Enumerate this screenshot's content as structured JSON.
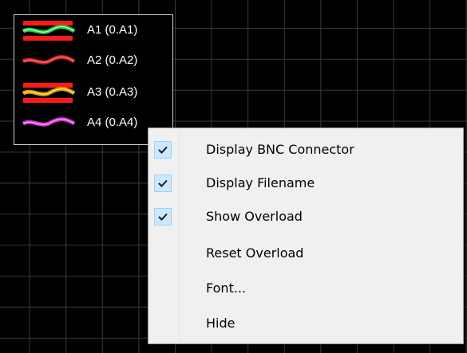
{
  "legend": {
    "items": [
      {
        "label": "A1 (0.A1)",
        "wave_color": "#22cc44",
        "overload": true
      },
      {
        "label": "A2 (0.A2)",
        "wave_color": "#cc2222",
        "overload": false
      },
      {
        "label": "A3 (0.A3)",
        "wave_color": "#d4a000",
        "overload": true
      },
      {
        "label": "A4 (0.A4)",
        "wave_color": "#cc33cc",
        "overload": false
      }
    ]
  },
  "context_menu": {
    "items": [
      {
        "label": "Display BNC Connector",
        "checked": true,
        "icon": "checkmark-icon"
      },
      {
        "label": "Display Filename",
        "checked": true,
        "icon": "checkmark-icon"
      },
      {
        "label": "Show Overload",
        "checked": true,
        "icon": "checkmark-icon"
      },
      {
        "label": "Reset Overload",
        "checked": false
      },
      {
        "label": "Font...",
        "checked": false
      },
      {
        "label": "Hide",
        "checked": false
      }
    ]
  },
  "colors": {
    "background": "#000000",
    "grid": "#3a3a3a",
    "overload_bar": "#ff1a1a",
    "check_highlight": "#cce8ff"
  }
}
